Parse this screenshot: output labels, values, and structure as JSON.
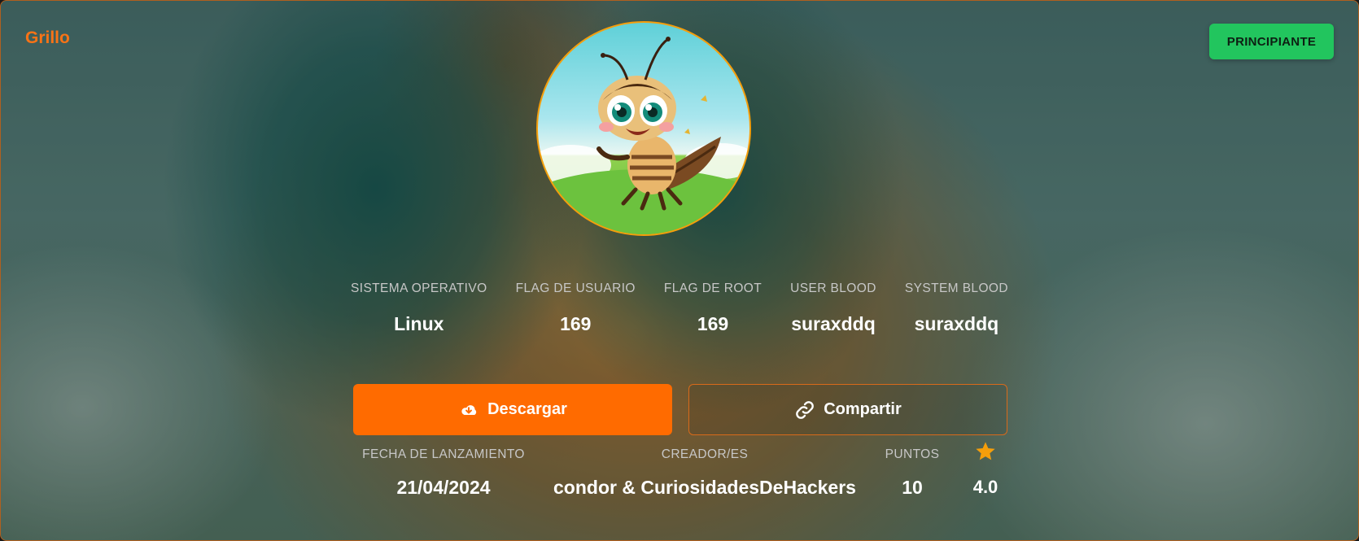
{
  "machine": {
    "name": "Grillo",
    "difficulty": "PRINCIPIANTE"
  },
  "colors": {
    "accent": "#ff6b00",
    "difficulty_badge": "#22c55e",
    "rating_star": "#f59e0b"
  },
  "stats": [
    {
      "label": "SISTEMA OPERATIVO",
      "value": "Linux"
    },
    {
      "label": "FLAG DE USUARIO",
      "value": "169"
    },
    {
      "label": "FLAG DE ROOT",
      "value": "169"
    },
    {
      "label": "USER BLOOD",
      "value": "suraxddq"
    },
    {
      "label": "SYSTEM BLOOD",
      "value": "suraxddq"
    }
  ],
  "actions": {
    "download_label": "Descargar",
    "download_icon": "cloud-download-icon",
    "share_label": "Compartir",
    "share_icon": "link-icon"
  },
  "meta": {
    "release_label": "FECHA DE LANZAMIENTO",
    "release_date": "21/04/2024",
    "creators_label": "CREADOR/ES",
    "creators": "condor & CuriosidadesDeHackers",
    "points_label": "PUNTOS",
    "points": "10",
    "rating_icon": "star-icon",
    "rating": "4.0"
  }
}
